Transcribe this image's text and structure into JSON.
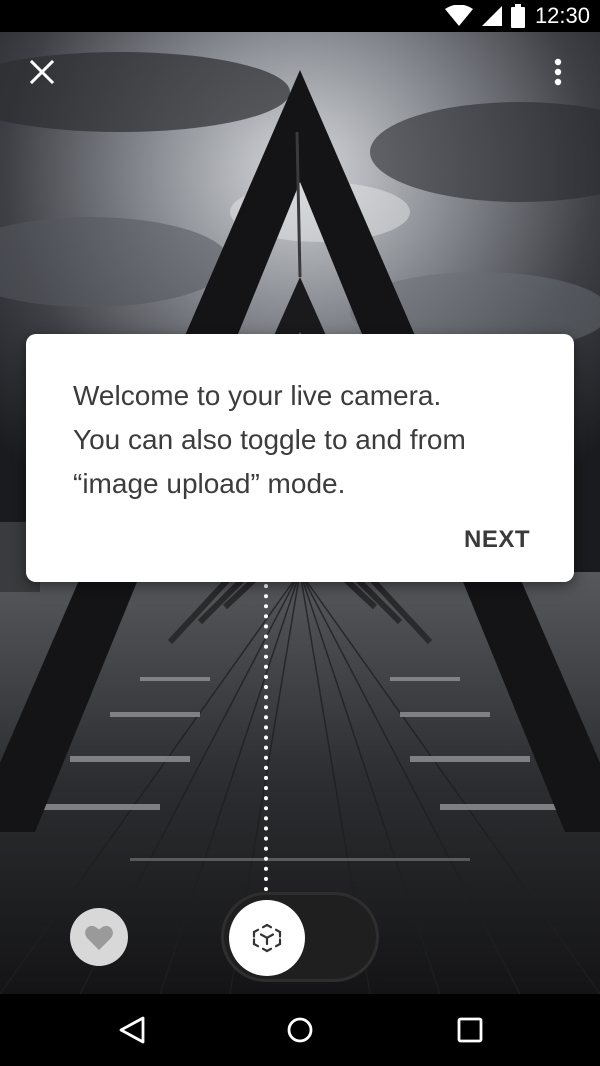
{
  "status_bar": {
    "time": "12:30",
    "icons": [
      "wifi-icon",
      "cell-signal-icon",
      "battery-icon"
    ]
  },
  "toolbar": {
    "close_icon": "close-icon",
    "more_icon": "more-vertical-icon"
  },
  "tooltip": {
    "lines": [
      "Welcome to your live camera.",
      "You can also toggle to and from",
      "“image upload” mode."
    ],
    "next_label": "NEXT"
  },
  "controls": {
    "favorite_icon": "heart-icon",
    "mode_toggle_icon": "ar-cube-icon",
    "mode_toggle_state": "live-camera"
  },
  "nav_bar": {
    "icons": [
      "back-icon",
      "home-icon",
      "recents-icon"
    ]
  },
  "colors": {
    "tooltip_background": "#ffffff",
    "tooltip_text": "#3c3c3c",
    "favorite_background": "#d8d8d8",
    "toggle_track": "#1f1f1f",
    "toggle_knob": "#ffffff"
  }
}
